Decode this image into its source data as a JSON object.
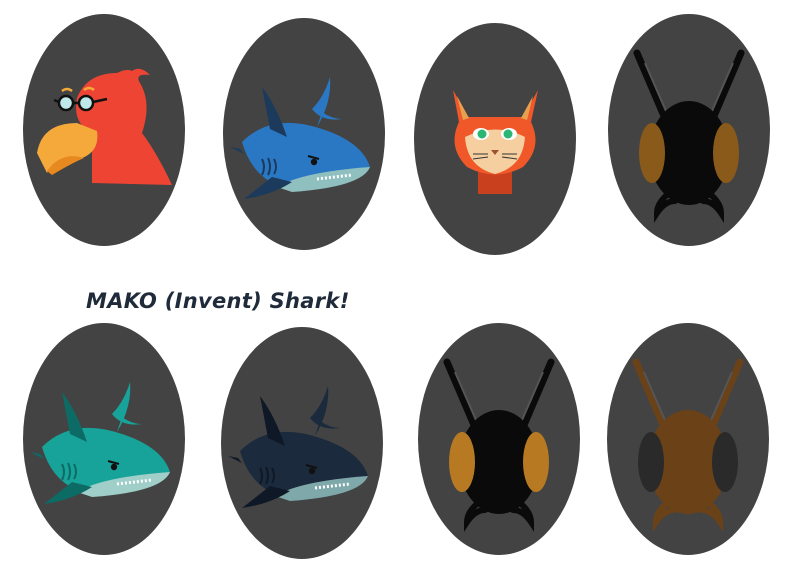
{
  "caption": "MAKO (Invent) Shark!",
  "colors": {
    "oval": "#434343",
    "background": "#ffffff",
    "caption": "#1f2a3a"
  },
  "avatars": [
    {
      "kind": "bird",
      "body": "#ee4433",
      "beak": "#f6a93b"
    },
    {
      "kind": "shark",
      "body": "#2a78c4",
      "fin": "#1b3a5c",
      "belly": "#8fbfbf"
    },
    {
      "kind": "cat",
      "body": "#f0582a",
      "eyes": "#2bb673"
    },
    {
      "kind": "bug",
      "body": "#0a0a0a",
      "wings": "#8a5a1a"
    },
    {
      "kind": "shark",
      "body": "#17a39a",
      "fin": "#0d6b66",
      "belly": "#9fcfc8"
    },
    {
      "kind": "shark",
      "body": "#1b2a3d",
      "fin": "#0f1826",
      "belly": "#7fa8aa"
    },
    {
      "kind": "bug",
      "body": "#0a0a0a",
      "wings": "#b77a22"
    },
    {
      "kind": "bug",
      "body": "#6b4218",
      "wings": "#2a2a2a"
    }
  ]
}
